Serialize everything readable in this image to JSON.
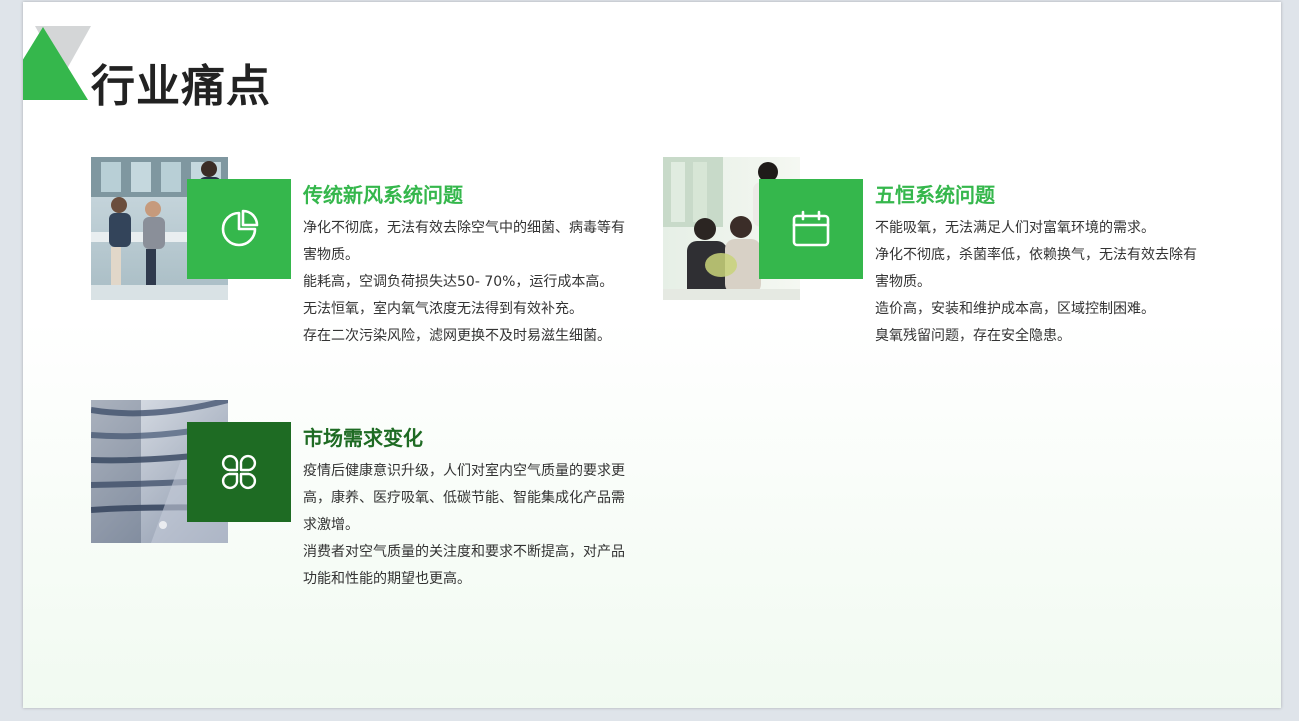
{
  "title": "行业痛点",
  "colors": {
    "accent_green": "#35b74c",
    "dark_green": "#1e6b23"
  },
  "cards": [
    {
      "icon": "pie-chart-icon",
      "title": "传统新风系统问题",
      "lines": [
        "净化不彻底，无法有效去除空气中的细菌、病毒等有害物质。",
        "能耗高，空调负荷损失达50- 70%，运行成本高。",
        "无法恒氧，室内氧气浓度无法得到有效补充。",
        "存在二次污染风险，滤网更换不及时易滋生细菌。"
      ]
    },
    {
      "icon": "calendar-icon",
      "title": "五恒系统问题",
      "lines": [
        "不能吸氧，无法满足人们对富氧环境的需求。",
        "净化不彻底，杀菌率低，依赖换气，无法有效去除有害物质。",
        "造价高，安装和维护成本高，区域控制困难。",
        "臭氧残留问题，存在安全隐患。"
      ]
    },
    {
      "icon": "four-leaf-icon",
      "title": "市场需求变化",
      "lines": [
        "疫情后健康意识升级，人们对室内空气质量的要求更高，康养、医疗吸氧、低碳节能、智能集成化产品需求激增。",
        "消费者对空气质量的关注度和要求不断提高，对产品功能和性能的期望也更高。"
      ]
    }
  ]
}
